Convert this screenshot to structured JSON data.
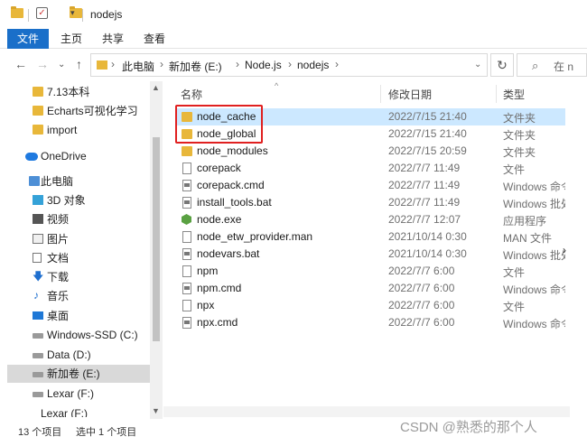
{
  "window": {
    "title": "nodejs"
  },
  "ribbon": {
    "tabs": [
      "文件",
      "主页",
      "共享",
      "查看"
    ]
  },
  "address": {
    "crumbs": [
      "此电脑",
      "新加卷 (E:)",
      "Node.js",
      "nodejs"
    ],
    "search_placeholder": "在 n"
  },
  "nav": {
    "items": [
      {
        "label": "7.13本科",
        "icon": "folder-icon"
      },
      {
        "label": "Echarts可视化学习",
        "icon": "folder-icon"
      },
      {
        "label": "import",
        "icon": "folder-icon"
      },
      {
        "label": "OneDrive",
        "icon": "onedrive-icon"
      },
      {
        "label": "此电脑",
        "icon": "computer-icon"
      },
      {
        "label": "3D 对象",
        "icon": "3d-objects-icon"
      },
      {
        "label": "视频",
        "icon": "video-icon"
      },
      {
        "label": "图片",
        "icon": "pictures-icon"
      },
      {
        "label": "文档",
        "icon": "documents-icon"
      },
      {
        "label": "下载",
        "icon": "download-icon"
      },
      {
        "label": "音乐",
        "icon": "music-icon"
      },
      {
        "label": "桌面",
        "icon": "desktop-icon"
      },
      {
        "label": "Windows-SSD (C:)",
        "icon": "drive-icon"
      },
      {
        "label": "Data (D:)",
        "icon": "drive-icon"
      },
      {
        "label": "新加卷 (E:)",
        "icon": "drive-icon",
        "selected": true
      },
      {
        "label": "Lexar (F:)",
        "icon": "drive-icon"
      },
      {
        "label": "Lexar (F:)",
        "icon": "drive-icon"
      }
    ]
  },
  "columns": {
    "name": "名称",
    "date": "修改日期",
    "type": "类型"
  },
  "files": [
    {
      "name": "node_cache",
      "date": "2022/7/15 21:40",
      "type": "文件夹",
      "icon": "folder-icon",
      "state": "selected"
    },
    {
      "name": "node_global",
      "date": "2022/7/15 21:40",
      "type": "文件夹",
      "icon": "folder-icon"
    },
    {
      "name": "node_modules",
      "date": "2022/7/15 20:59",
      "type": "文件夹",
      "icon": "folder-icon"
    },
    {
      "name": "corepack",
      "date": "2022/7/7 11:49",
      "type": "文件",
      "icon": "file-icon"
    },
    {
      "name": "corepack.cmd",
      "date": "2022/7/7 11:49",
      "type": "Windows 命令脚本",
      "icon": "cmd-icon"
    },
    {
      "name": "install_tools.bat",
      "date": "2022/7/7 11:49",
      "type": "Windows 批处理文件",
      "icon": "cmd-icon"
    },
    {
      "name": "node.exe",
      "date": "2022/7/7 12:07",
      "type": "应用程序",
      "icon": "node-exe-icon"
    },
    {
      "name": "node_etw_provider.man",
      "date": "2021/10/14 0:30",
      "type": "MAN 文件",
      "icon": "file-icon"
    },
    {
      "name": "nodevars.bat",
      "date": "2021/10/14 0:30",
      "type": "Windows 批处理文件",
      "icon": "cmd-icon"
    },
    {
      "name": "npm",
      "date": "2022/7/7 6:00",
      "type": "文件",
      "icon": "file-icon"
    },
    {
      "name": "npm.cmd",
      "date": "2022/7/7 6:00",
      "type": "Windows 命令脚本",
      "icon": "cmd-icon"
    },
    {
      "name": "npx",
      "date": "2022/7/7 6:00",
      "type": "文件",
      "icon": "file-icon"
    },
    {
      "name": "npx.cmd",
      "date": "2022/7/7 6:00",
      "type": "Windows 命令脚本",
      "icon": "cmd-icon"
    }
  ],
  "status": {
    "count": "13 个项目",
    "selection": "选中 1 个项目"
  },
  "watermark": "CSDN @熟悉的那个人",
  "colors": {
    "accent": "#1a6fc9",
    "selection": "#cce8ff",
    "highlight_box": "#e02020",
    "folder": "#e8b73a"
  }
}
